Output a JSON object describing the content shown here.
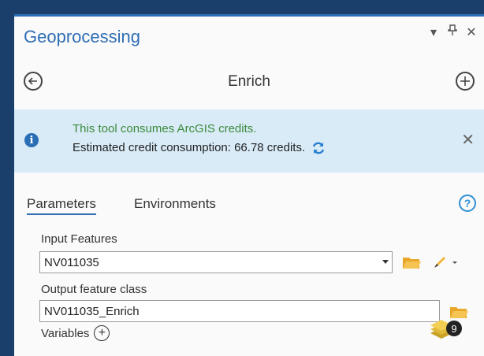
{
  "panel": {
    "title": "Geoprocessing"
  },
  "window_controls": {
    "menu": "▾",
    "pin": "ᵠ",
    "close": "✕"
  },
  "nav": {
    "tool_name": "Enrich"
  },
  "banner": {
    "line1": "This tool consumes ArcGIS credits.",
    "line2": "Estimated credit consumption: 66.78 credits."
  },
  "tabs": [
    {
      "label": "Parameters",
      "active": true
    },
    {
      "label": "Environments",
      "active": false
    }
  ],
  "params": {
    "input_label": "Input Features",
    "input_value": "NV011035",
    "output_label": "Output feature class",
    "output_value": "NV011035_Enrich",
    "variables_label": "Variables"
  },
  "layers_badge": "9",
  "colors": {
    "accent": "#2f6eb5",
    "banner_bg": "#d9ebf7",
    "credit_text": "#3a8a3a",
    "folder": "#f2b53b"
  }
}
